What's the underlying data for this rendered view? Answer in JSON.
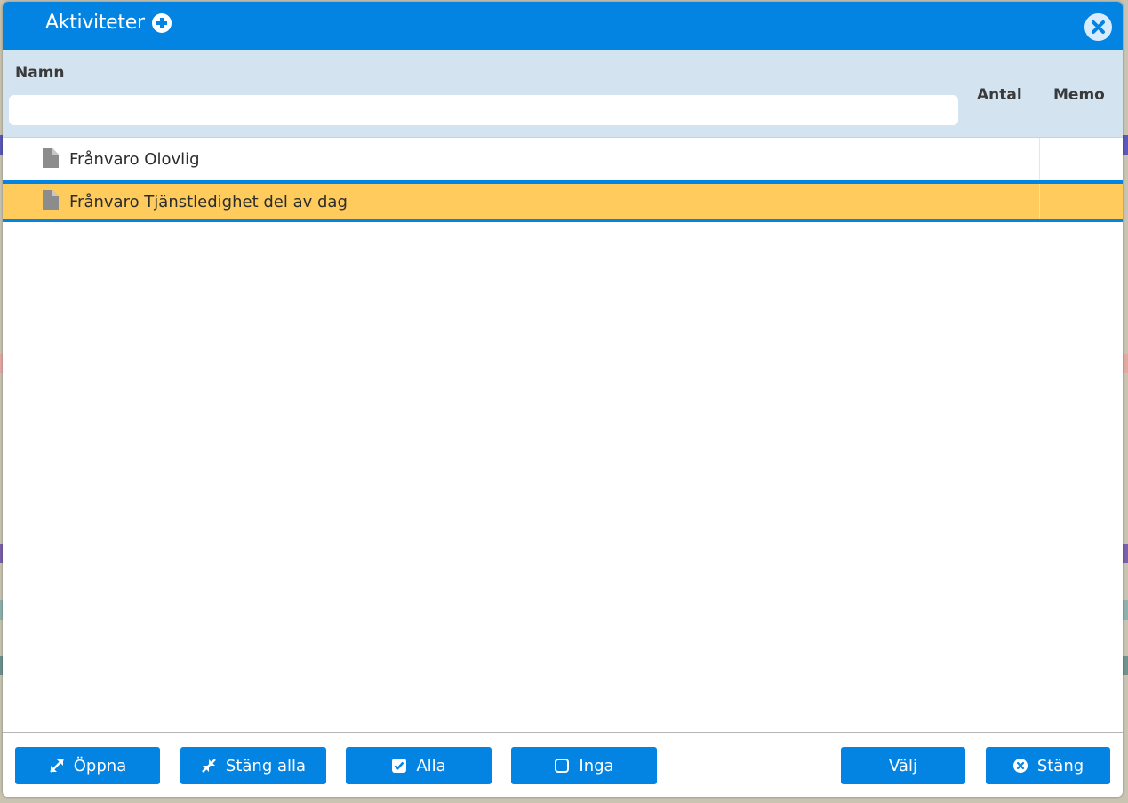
{
  "colors": {
    "accent": "#0384e3",
    "header_bg": "#d3e3f0",
    "selected_row": "#fecb5c"
  },
  "dialog": {
    "title": "Aktiviteter",
    "add_icon": "plus-circle-icon",
    "close_icon": "close-circle-icon"
  },
  "columns": {
    "namn": "Namn",
    "antal": "Antal",
    "memo": "Memo"
  },
  "search": {
    "value": "",
    "placeholder": ""
  },
  "rows": [
    {
      "label": "Frånvaro Olovlig",
      "icon": "document-icon",
      "antal": "",
      "memo": "",
      "selected": false
    },
    {
      "label": "Frånvaro Tjänstledighet del av dag",
      "icon": "document-icon",
      "antal": "",
      "memo": "",
      "selected": true
    }
  ],
  "footer": {
    "oppna": "Öppna",
    "stang_alla": "Stäng alla",
    "alla": "Alla",
    "inga": "Inga",
    "valj": "Välj",
    "stang": "Stäng"
  }
}
